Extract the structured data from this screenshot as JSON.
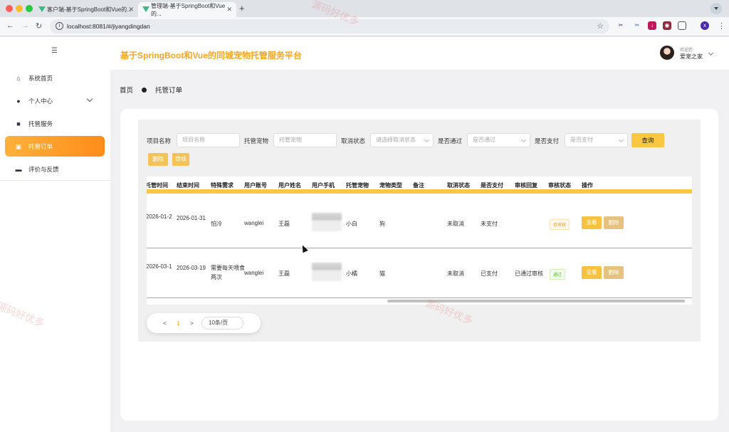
{
  "browser": {
    "tabs": [
      {
        "title": "客户端-基于SpringBoot和Vue的...",
        "active": false
      },
      {
        "title": "管理端-基于SpringBoot和Vue的...",
        "active": true
      }
    ],
    "url": "localhost:8081/#/jiyangdingdan",
    "colors": {
      "traffic_red": "#ff5f57",
      "traffic_yellow": "#febc2e",
      "traffic_green": "#28c840"
    }
  },
  "sidebar": {
    "items": [
      {
        "label": "系统首页",
        "icon": "home-icon"
      },
      {
        "label": "个人中心",
        "icon": "user-icon",
        "expandable": true
      },
      {
        "label": "托管服务",
        "icon": "briefcase-icon"
      },
      {
        "label": "托管订单",
        "icon": "clipboard-icon",
        "active": true
      },
      {
        "label": "评价与反馈",
        "icon": "monitor-icon"
      }
    ]
  },
  "header": {
    "title": "基于SpringBoot和Vue的同城宠物托管服务平台",
    "welcome": "欢迎您",
    "username": "爱宠之家"
  },
  "breadcrumb": {
    "home": "首页",
    "current": "托管订单"
  },
  "search": {
    "fields": [
      {
        "label": "项目名称",
        "placeholder": "项目名称"
      },
      {
        "label": "托管宠物",
        "placeholder": "托管宠物"
      },
      {
        "label": "取消状态",
        "placeholder": "请选择取消状态"
      },
      {
        "label": "是否通过",
        "placeholder": "是否通过"
      },
      {
        "label": "是否支付",
        "placeholder": "是否支付"
      }
    ],
    "query_label": "查询",
    "delete_label": "删除",
    "audit_label": "审核"
  },
  "table": {
    "headers": [
      "托管时间",
      "结束时间",
      "特殊需求",
      "用户账号",
      "用户姓名",
      "用户手机",
      "托管宠物",
      "宠物类型",
      "备注",
      "取消状态",
      "是否支付",
      "审核回复",
      "审核状态",
      "操作"
    ],
    "rows": [
      {
        "start": "2026-01-2",
        "end": "2026-01-31",
        "special": "怕冷",
        "account": "wanglei",
        "name": "王磊",
        "pet": "小白",
        "type": "狗",
        "note": "",
        "cancel": "未取消",
        "paid": "未支付",
        "reply": "",
        "status": "待审核"
      },
      {
        "start": "2026-03-1",
        "end": "2026-03-19",
        "special": "需要每天喂食两次",
        "account": "wanglei",
        "name": "王磊",
        "pet": "小橘",
        "type": "猫",
        "note": "",
        "cancel": "未取消",
        "paid": "已支付",
        "reply": "已通过审核",
        "status": "通过"
      }
    ],
    "view_label": "查看",
    "delete_label": "删除"
  },
  "pagination": {
    "prev": "<",
    "page": "1",
    "next": ">",
    "size": "10条/页"
  },
  "watermark": "源码好优多",
  "accent": "#fac742"
}
